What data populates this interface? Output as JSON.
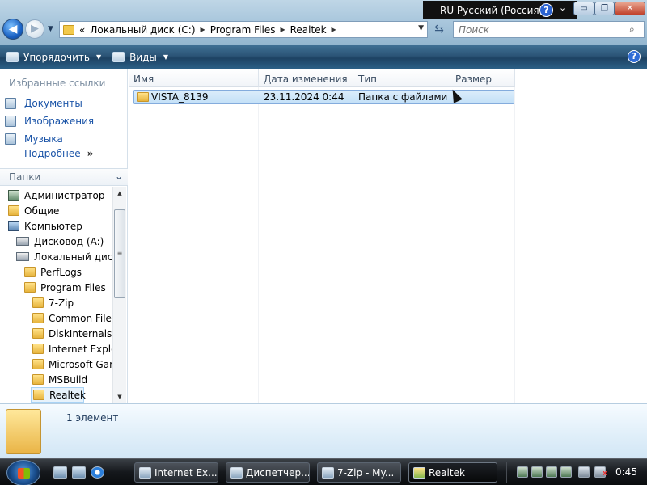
{
  "langbar": {
    "label": "RU Русский (Россия)",
    "help": "?",
    "options": "⌄"
  },
  "window_buttons": {
    "minimize": "▭",
    "maximize": "❐",
    "close": "✕"
  },
  "address": {
    "crumbs": [
      "«",
      "Локальный диск (C:)",
      "Program Files",
      "Realtek"
    ],
    "search_placeholder": "Поиск"
  },
  "toolbar": {
    "organize_label": "Упорядочить",
    "views_label": "Виды",
    "help": "?"
  },
  "favorites": {
    "header": "Избранные ссылки",
    "items": [
      "Документы",
      "Изображения",
      "Музыка"
    ],
    "more": "Подробнее",
    "more_chevron": "»"
  },
  "folders": {
    "header": "Папки",
    "tree": [
      {
        "label": "Администратор",
        "type": "user",
        "level": 0
      },
      {
        "label": "Общие",
        "type": "folder",
        "level": 0
      },
      {
        "label": "Компьютер",
        "type": "computer",
        "level": 0
      },
      {
        "label": "Дисковод (A:)",
        "type": "drive",
        "level": 1
      },
      {
        "label": "Локальный диск (",
        "type": "drive",
        "level": 1
      },
      {
        "label": "PerfLogs",
        "type": "folder",
        "level": 2
      },
      {
        "label": "Program Files",
        "type": "folder",
        "level": 2
      },
      {
        "label": "7-Zip",
        "type": "folder",
        "level": 3
      },
      {
        "label": "Common Files",
        "type": "folder",
        "level": 3
      },
      {
        "label": "DiskInternals",
        "type": "folder",
        "level": 3
      },
      {
        "label": "Internet Explor",
        "type": "folder",
        "level": 3
      },
      {
        "label": "Microsoft Gam",
        "type": "folder",
        "level": 3
      },
      {
        "label": "MSBuild",
        "type": "folder",
        "level": 3
      },
      {
        "label": "Realtek",
        "type": "folder",
        "level": 3,
        "selected": true
      }
    ]
  },
  "filelist": {
    "columns": [
      "Имя",
      "Дата изменения",
      "Тип",
      "Размер"
    ],
    "rows": [
      {
        "name": "VISTA_8139",
        "date": "23.11.2024 0:44",
        "type": "Папка с файлами",
        "size": ""
      }
    ]
  },
  "details": {
    "count": "1 элемент"
  },
  "taskbar": {
    "tasks": [
      {
        "label": "Internet Ex..."
      },
      {
        "label": "Диспетчер..."
      },
      {
        "label": "7-Zip - My..."
      },
      {
        "label": "Realtek",
        "active": true
      }
    ],
    "tray_mute": "x",
    "clock": "0:45"
  }
}
